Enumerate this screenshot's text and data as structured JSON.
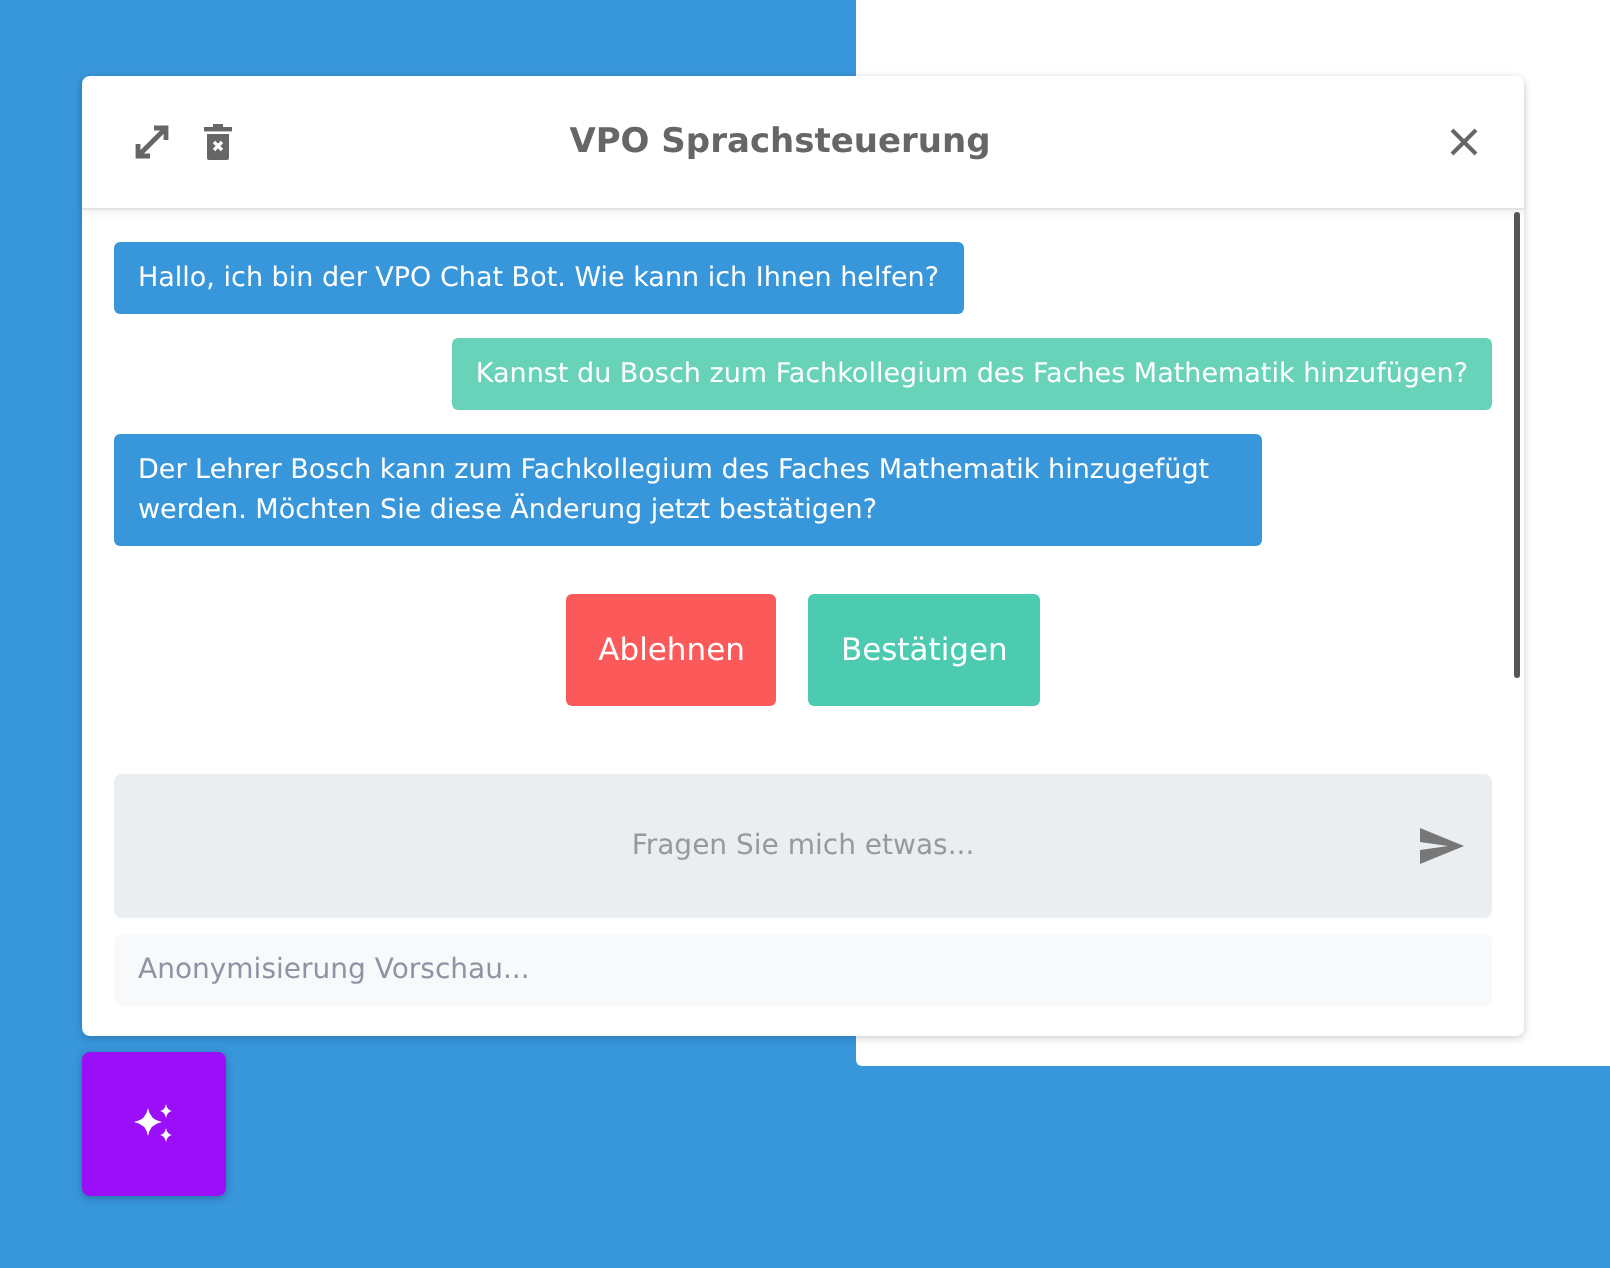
{
  "dialog": {
    "title": "VPO Sprachsteuerung"
  },
  "messages": [
    {
      "kind": "bot",
      "text": "Hallo, ich bin der VPO Chat Bot. Wie kann ich Ihnen helfen?"
    },
    {
      "kind": "user",
      "text": "Kannst du Bosch zum Fachkollegium des Faches Mathematik hinzufügen?"
    },
    {
      "kind": "bot",
      "text": "Der Lehrer Bosch kann zum Fachkollegium des Faches Mathematik hinzugefügt werden. Möchten Sie diese Änderung jetzt bestätigen?"
    }
  ],
  "actions": [
    {
      "kind": "reject",
      "label": "Ablehnen"
    },
    {
      "kind": "confirm",
      "label": "Bestätigen"
    }
  ],
  "input": {
    "placeholder": "Fragen Sie mich etwas..."
  },
  "preview": {
    "placeholder": "Anonymisierung Vorschau..."
  }
}
